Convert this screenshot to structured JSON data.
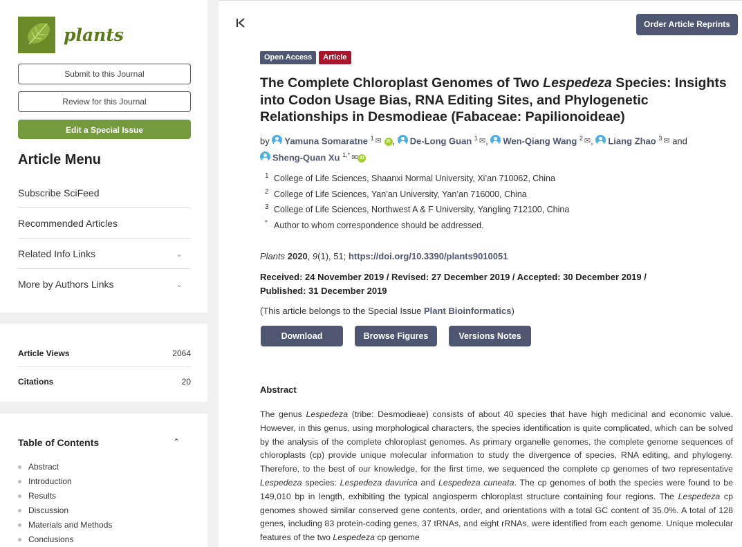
{
  "journal": {
    "name": "plants",
    "brand_color": "#6b8a27"
  },
  "sidebar": {
    "buttons": {
      "submit": "Submit to this Journal",
      "review": "Review for this Journal",
      "special_issue": "Edit a Special Issue"
    },
    "menu_title": "Article Menu",
    "menu_items": [
      {
        "label": "Subscribe SciFeed"
      },
      {
        "label": "Recommended Articles"
      },
      {
        "label": "Related Info Links",
        "chevron": "⌄"
      },
      {
        "label": "More by Authors Links",
        "chevron": "⌄"
      }
    ],
    "stats": [
      {
        "label": "Article Views",
        "value": "2064"
      },
      {
        "label": "Citations",
        "value": "20"
      }
    ],
    "toc": {
      "title": "Table of Contents",
      "toggle": "⌃",
      "items": [
        "Abstract",
        "Introduction",
        "Results",
        "Discussion",
        "Materials and Methods",
        "Conclusions"
      ]
    }
  },
  "header": {
    "reprints_button": "Order Article Reprints"
  },
  "article": {
    "badges": {
      "open_access": "Open Access",
      "type": "Article"
    },
    "title": {
      "part1": "The Complete Chloroplast Genomes of Two ",
      "italic": "Lespedeza",
      "part2": " Species: Insights into Codon Usage Bias, RNA Editing Sites, and Phylogenetic Relationships in Desmodieae (Fabaceae: Papilionoideae)"
    },
    "by": "by",
    "and": "and",
    "authors": [
      {
        "name": "Yamuna Somaratne",
        "sup": "1"
      },
      {
        "name": "De-Long Guan",
        "sup": "1"
      },
      {
        "name": "Wen-Qiang Wang",
        "sup": "2"
      },
      {
        "name": "Liang Zhao",
        "sup": "3"
      },
      {
        "name": "Sheng-Quan Xu",
        "sup": "1,*"
      }
    ],
    "affiliations": [
      {
        "num": "1",
        "text": "College of Life Sciences, Shaanxi Normal University, Xi’an 710062, China"
      },
      {
        "num": "2",
        "text": "College of Life Sciences, Yan’an University, Yan’an 716000, China"
      },
      {
        "num": "3",
        "text": "College of Life Sciences, Northwest A & F University, Yangling 712100, China"
      },
      {
        "num": "*",
        "text": "Author to whom correspondence should be addressed."
      }
    ],
    "citation": {
      "journal": "Plants",
      "year": "2020",
      "volume": "9",
      "issue": "(1)",
      "article_no": ", 51; ",
      "doi": "https://doi.org/10.3390/plants9010051"
    },
    "dates": "Received: 24 November 2019 / Revised: 27 December 2019 / Accepted: 30 December 2019 / Published: 31 December 2019",
    "special_issue": {
      "prefix": "(This article belongs to the Special Issue ",
      "link": "Plant Bioinformatics",
      "suffix": ")"
    },
    "actions": {
      "download": "Download",
      "figures": "Browse Figures",
      "versions": "Versions Notes"
    },
    "abstract": {
      "heading": "Abstract",
      "segments": [
        {
          "t": "The genus "
        },
        {
          "t": "Lespedeza",
          "i": true
        },
        {
          "t": " (tribe: Desmodieae) consists of about 40 species that have high medicinal and economic value. However, in this genus, using morphological characters, the species identification is quite complicated, which can be solved by the analysis of the complete chloroplast genomes. As primary organelle genomes, the complete genome sequences of chloroplasts (cp) provide unique molecular information to study the divergence of species, RNA editing, and phylogeny. Therefore, to the best of our knowledge, for the first time, we sequenced the complete cp genomes of two representative "
        },
        {
          "t": "Lespedeza",
          "i": true
        },
        {
          "t": " species: "
        },
        {
          "t": "Lespedeza davurica",
          "i": true
        },
        {
          "t": " and "
        },
        {
          "t": "Lespedeza cuneata",
          "i": true
        },
        {
          "t": ". The cp genomes of both the species were found to be 149,010 bp in length, exhibiting the typical angiosperm chloroplast structure containing four regions. The "
        },
        {
          "t": "Lespedeza",
          "i": true
        },
        {
          "t": " cp genomes showed similar conserved gene contents, order, and orientations with a total GC content of 35.0%. A total of 128 genes, including 83 protein-coding genes, 37 tRNAs, and eight rRNAs, were identified from each genome. Unique molecular features of the two "
        },
        {
          "t": "Lespedeza",
          "i": true
        },
        {
          "t": " cp genome"
        }
      ]
    }
  },
  "colors": {
    "primary": "#4f5671",
    "article_badge": "#a8162d",
    "green_button": "#739a3c",
    "person_icon": "#4ab0e6",
    "orcid": "#a6ce39"
  }
}
